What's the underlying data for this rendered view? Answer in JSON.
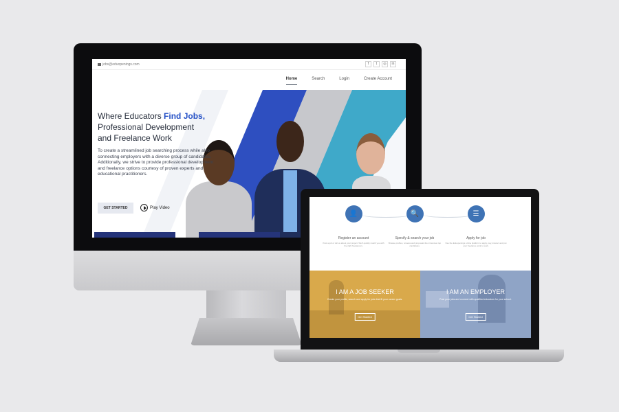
{
  "desktop": {
    "topbar": {
      "email": "jobs@eduopenings.com",
      "social_icons": [
        "facebook-icon",
        "twitter-icon",
        "instagram-icon",
        "linkedin-icon"
      ],
      "social_glyphs": [
        "f",
        "t",
        "◎",
        "in"
      ]
    },
    "nav": {
      "items": [
        "Home",
        "Search",
        "Login",
        "Create Account"
      ],
      "active": "Home"
    },
    "hero": {
      "title_line1_prefix": "Where Educators ",
      "title_line1_accent": "Find Jobs,",
      "title_line2": "Professional Development",
      "title_line3": "and Freelance Work",
      "description": "To create a streamlined job searching process while also connecting employers with a diverse group of candidates. Additionally, we strive to provide professional development and freelance options courtesy of proven experts and educational practitioners.",
      "cta_label": "GET STARTED",
      "play_label": "Play Video"
    },
    "colors": {
      "accent": "#2450c6",
      "stripe_blue": "#2e4fc0",
      "stripe_gray": "#c7c8cc",
      "stripe_teal": "#3fa9c9"
    }
  },
  "laptop": {
    "steps": [
      {
        "icon": "user-icon",
        "glyph": "👤",
        "title": "Register an account",
        "desc": "Post a job or tell us about your project. We'll quickly match you with the right freelancers."
      },
      {
        "icon": "search-document-icon",
        "glyph": "🔍",
        "title": "Specify & search your job",
        "desc": "Browse profiles, reviews and proposals then interview top candidates."
      },
      {
        "icon": "list-icon",
        "glyph": "☰",
        "title": "Apply for job",
        "desc": "Use the Eduopenings online platform to apply, pay, interact and put your freelance work to work."
      }
    ],
    "panels": [
      {
        "title": "I AM A JOB SEEKER",
        "desc": "Create your profile, search and apply for jobs that fit your career goals.",
        "button": "Get Started"
      },
      {
        "title": "I AM AN EMPLOYER",
        "desc": "Post your jobs and connect with qualified educators for your school.",
        "button": "Get Started"
      }
    ],
    "colors": {
      "step_circle": "#3f73b5",
      "seeker_overlay": "#d9a94b",
      "employer_overlay": "#8fa4c6"
    }
  }
}
